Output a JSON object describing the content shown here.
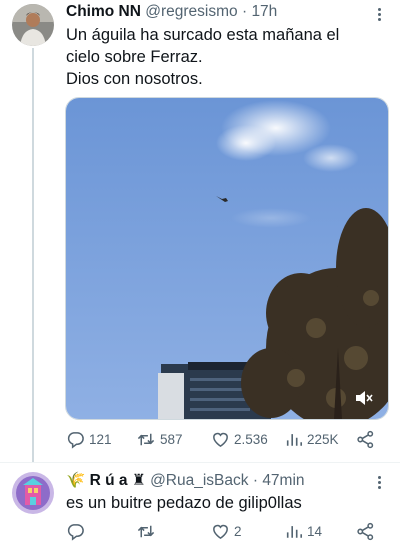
{
  "tweet": {
    "author_name": "Chimo NN",
    "handle": "@regresismo",
    "separator": "·",
    "time": "17h",
    "text_lines": [
      "Un águila ha surcado esta mañana el",
      "cielo sobre Ferraz.",
      "Dios con nosotros."
    ],
    "video": {
      "muted": true,
      "icon": "mute-icon"
    },
    "actions": {
      "replies": "121",
      "retweets": "587",
      "likes": "2.536",
      "views": "225K"
    }
  },
  "reply": {
    "author_prefix_emoji": "🌾",
    "author_name": "R ú a",
    "author_suffix_emoji": "♜",
    "handle": "@Rua_isBack",
    "separator": "·",
    "time": "47min",
    "text": "es un buitre pedazo de gilip0llas",
    "actions": {
      "replies": "",
      "retweets": "",
      "likes": "2",
      "views": "14"
    }
  },
  "colors": {
    "text": "#0f1419",
    "secondary": "#536471",
    "thread": "#cfd9de",
    "sky": "#5f8fd6"
  }
}
